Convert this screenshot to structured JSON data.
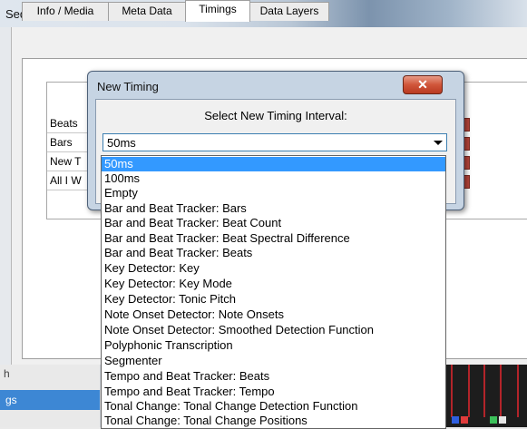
{
  "window": {
    "title": "Sequence Settings"
  },
  "tabs": [
    {
      "label": "Info / Media"
    },
    {
      "label": "Meta Data"
    },
    {
      "label": "Timings"
    },
    {
      "label": "Data Layers"
    }
  ],
  "timings_rows": [
    "Beats",
    "Bars",
    "New T",
    "All I W"
  ],
  "left_panel": {
    "top_text": "h",
    "selected": "gs"
  },
  "dialog": {
    "title": "New Timing",
    "close_symbol": "✕",
    "prompt": "Select New Timing Interval:",
    "selected_value": "50ms"
  },
  "dropdown_options": [
    "50ms",
    "100ms",
    "Empty",
    "Bar and Beat Tracker: Bars",
    "Bar and Beat Tracker: Beat Count",
    "Bar and Beat Tracker: Beat Spectral Difference",
    "Bar and Beat Tracker: Beats",
    "Key Detector: Key",
    "Key Detector: Key Mode",
    "Key Detector: Tonic Pitch",
    "Note Onset Detector: Note Onsets",
    "Note Onset Detector: Smoothed Detection Function",
    "Polyphonic Transcription",
    "Segmenter",
    "Tempo and Beat Tracker: Beats",
    "Tempo and Beat Tracker: Tempo",
    "Tonal Change: Tonal Change Detection Function",
    "Tonal Change: Tonal Change Positions"
  ],
  "colors": {
    "selection": "#3399ff",
    "close_button": "#c9462b",
    "dialog_frame": "#c6d4e3"
  }
}
